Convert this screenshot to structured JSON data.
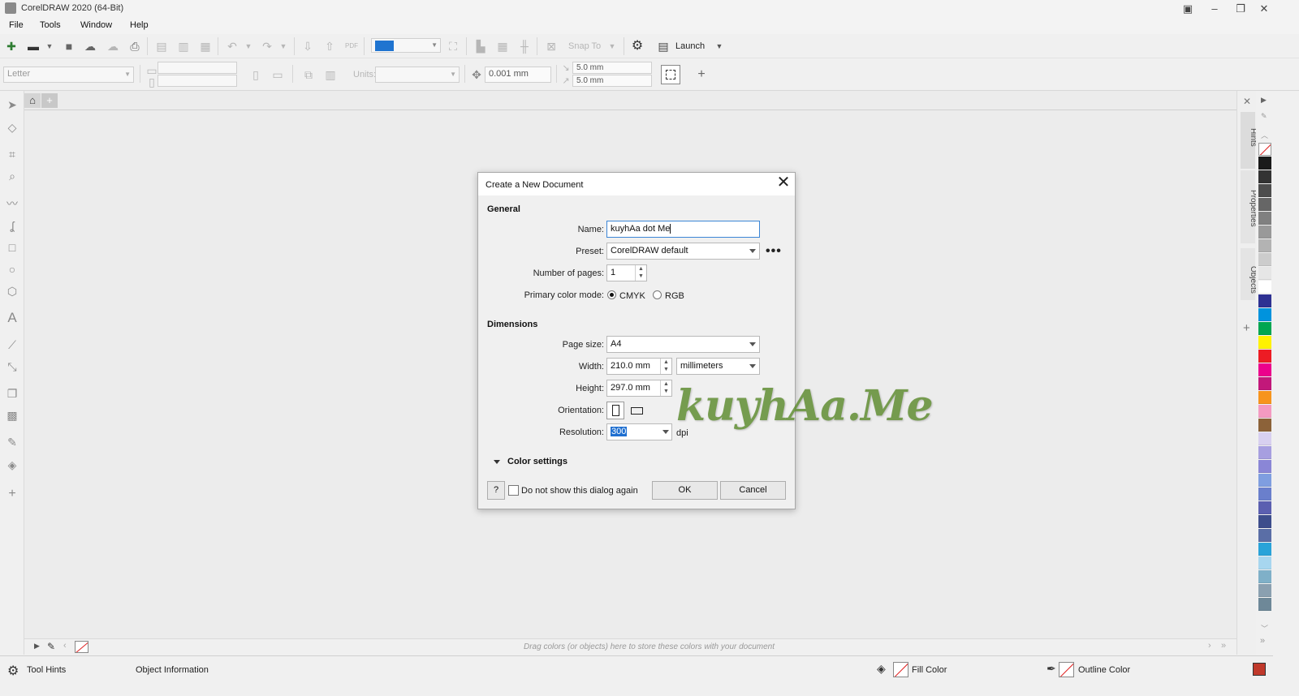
{
  "window": {
    "title": "CorelDRAW 2020 (64-Bit)"
  },
  "menu": {
    "file": "File",
    "tools": "Tools",
    "window": "Window",
    "help": "Help"
  },
  "toolbar": {
    "snap_to": "Snap To",
    "launch": "Launch",
    "page_size_placeholder": "Letter",
    "units_label": "Units:",
    "nudge": "0.001 mm",
    "dup_x": "5.0 mm",
    "dup_y": "5.0 mm"
  },
  "document_palette_hint": "Drag colors (or objects) here to store these colors with your document",
  "status": {
    "tool_hints": "Tool Hints",
    "object_info": "Object Information",
    "fill_color": "Fill Color",
    "outline_color": "Outline Color"
  },
  "dockers": {
    "hints": "Hints",
    "properties": "Properties",
    "objects": "Objects"
  },
  "dialog": {
    "title": "Create a New Document",
    "general_heading": "General",
    "name_label": "Name:",
    "name_value": "kuyhAa dot Me",
    "preset_label": "Preset:",
    "preset_value": "CorelDRAW default",
    "pages_label": "Number of pages:",
    "pages_value": "1",
    "color_mode_label": "Primary color mode:",
    "cmyk": "CMYK",
    "rgb": "RGB",
    "dimensions_heading": "Dimensions",
    "page_size_label": "Page size:",
    "page_size_value": "A4",
    "width_label": "Width:",
    "width_value": "210.0 mm",
    "units_value": "millimeters",
    "height_label": "Height:",
    "height_value": "297.0 mm",
    "orientation_label": "Orientation:",
    "resolution_label": "Resolution:",
    "resolution_value": "300",
    "dpi": "dpi",
    "color_settings": "Color settings",
    "help_btn": "?",
    "dont_show": "Do not show this dialog again",
    "ok": "OK",
    "cancel": "Cancel"
  },
  "watermark": "kuyhAa.Me",
  "palette_colors": [
    "#ffffff",
    "#1a1a1a",
    "#333333",
    "#4d4d4d",
    "#666666",
    "#808080",
    "#999999",
    "#b3b3b3",
    "#cccccc",
    "#e6e6e6",
    "#ffffff",
    "#2e3192",
    "#0093dd",
    "#00a651",
    "#fff200",
    "#ed1c24",
    "#ec008c",
    "#c2187a",
    "#f7941d",
    "#f49ac1",
    "#8c6239",
    "#d8d0f0",
    "#a79fe0",
    "#8a86d6",
    "#7f9ee0",
    "#6a7fcc",
    "#5b5fb0",
    "#3d4d8c",
    "#5a6ea6",
    "#29a3d9",
    "#a7d6ef",
    "#7fb0c8",
    "#8aa0b0",
    "#6e8898"
  ]
}
